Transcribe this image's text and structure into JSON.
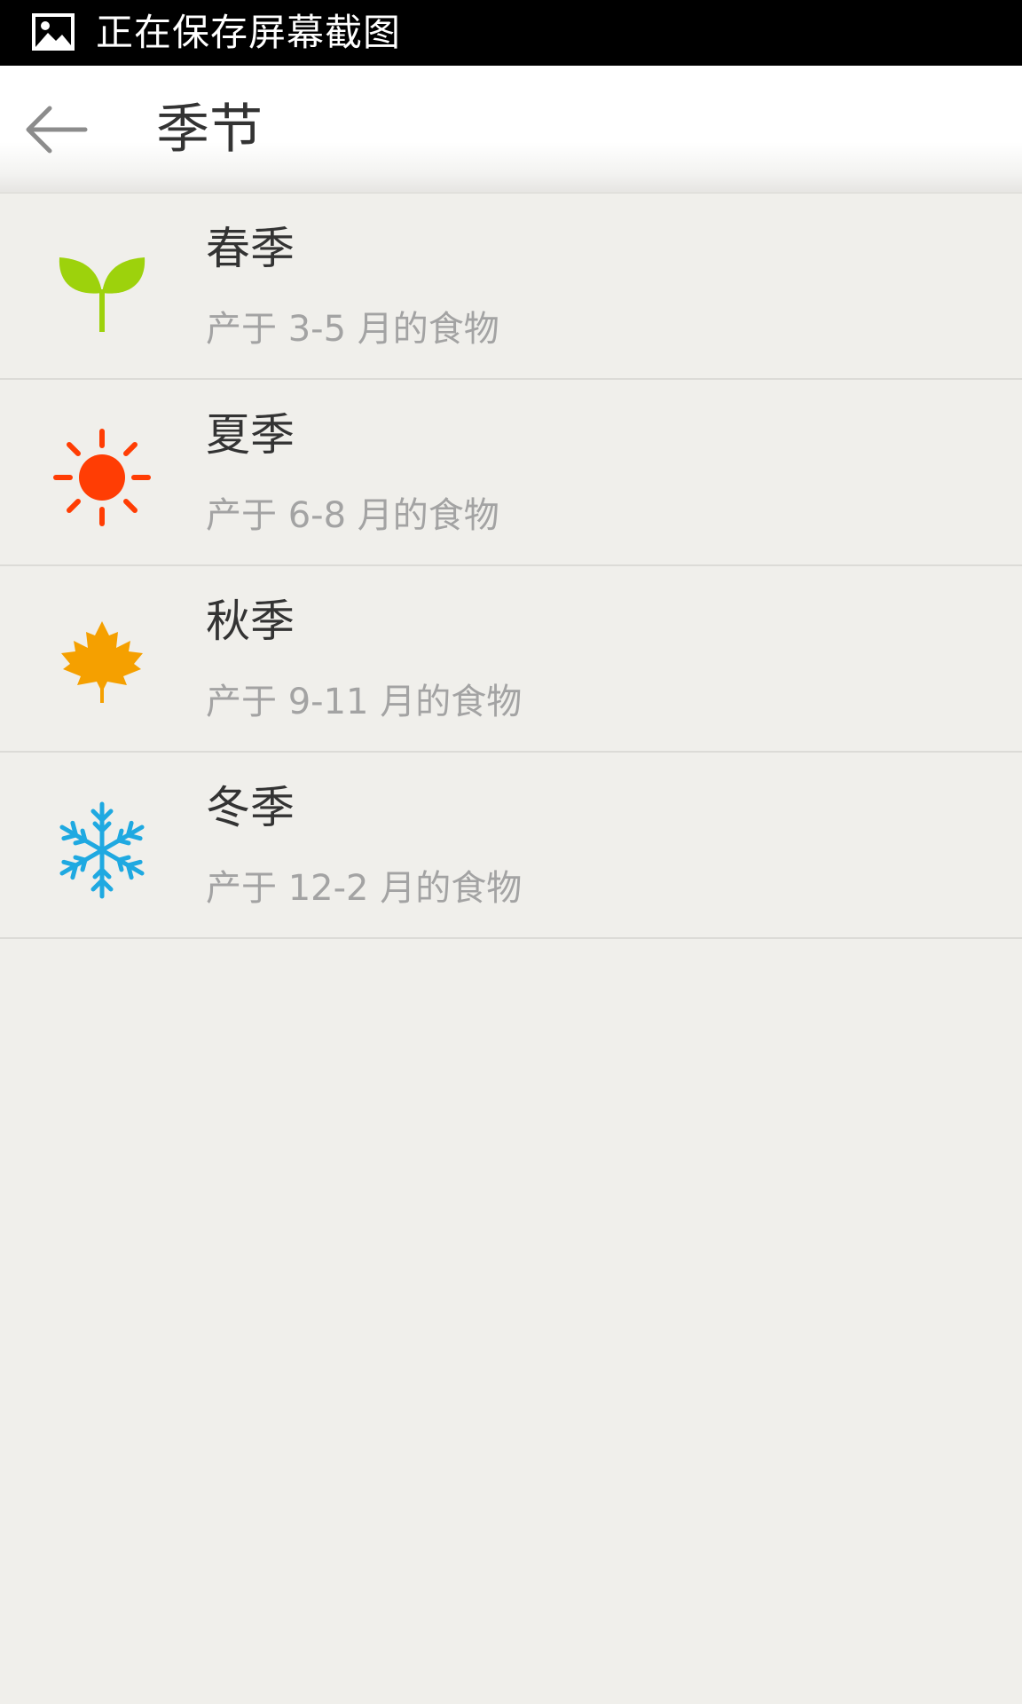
{
  "status_bar": {
    "notification_icon": "image-icon",
    "text": "正在保存屏幕截图"
  },
  "header": {
    "back_icon": "arrow-left-icon",
    "title": "季节"
  },
  "seasons": [
    {
      "name": "春季",
      "desc": "产于 3-5 月的食物",
      "icon": "sprout-icon",
      "color": "#9dd20c"
    },
    {
      "name": "夏季",
      "desc": "产于 6-8 月的食物",
      "icon": "sun-icon",
      "color": "#ff3d04"
    },
    {
      "name": "秋季",
      "desc": "产于 9-11 月的食物",
      "icon": "maple-leaf-icon",
      "color": "#f5a000"
    },
    {
      "name": "冬季",
      "desc": "产于 12-2 月的食物",
      "icon": "snowflake-icon",
      "color": "#1fa9e1"
    }
  ],
  "colors": {
    "background": "#f0efeb",
    "status_bar": "#000000",
    "title_text": "#333333",
    "secondary_text": "#a3a3a3"
  }
}
